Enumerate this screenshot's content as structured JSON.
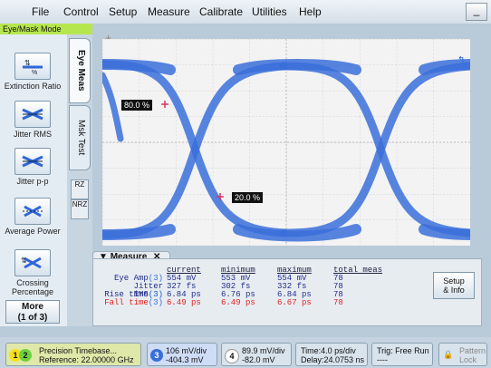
{
  "menu": {
    "items": [
      "File",
      "Control",
      "Setup",
      "Measure",
      "Calibrate",
      "Utilities",
      "Help"
    ],
    "minimize_label": "_"
  },
  "mode_label": "Eye/Mask Mode",
  "tools": [
    {
      "label": "Extinction Ratio",
      "icon": "extinction-ratio-icon"
    },
    {
      "label": "Jitter RMS",
      "icon": "jitter-rms-icon"
    },
    {
      "label": "Jitter p-p",
      "icon": "jitter-pp-icon"
    },
    {
      "label": "Average Power",
      "icon": "average-power-icon"
    },
    {
      "label": "Crossing Percentage",
      "icon": "crossing-percentage-icon"
    }
  ],
  "more_button": {
    "line1": "More",
    "line2": "(1 of 3)"
  },
  "vertical_tabs": {
    "eye_meas": "Eye Meas",
    "msk_test": "Msk Test"
  },
  "mini_tabs": {
    "rz": "RZ",
    "nrz": "NRZ"
  },
  "markers": {
    "upper": "80.0 %",
    "lower": "20.0 %"
  },
  "measure_panel": {
    "title": "Measure",
    "headers": [
      "current",
      "minimum",
      "maximum",
      "total meas"
    ],
    "rows": [
      {
        "label": "Eye Amp",
        "chan": "(3)",
        "current": "554 mV",
        "minimum": "553 mV",
        "maximum": "554 mV",
        "total": "78"
      },
      {
        "label": "Jitter RMS",
        "chan": "(3)",
        "current": "327 fs",
        "minimum": "302 fs",
        "maximum": "332 fs",
        "total": "78"
      },
      {
        "label": "Rise time",
        "chan": "(3)",
        "current": "6.84 ps",
        "minimum": "6.76 ps",
        "maximum": "6.84 ps",
        "total": "78"
      },
      {
        "label": "Fall time",
        "chan": "(3)",
        "current": "6.49 ps",
        "minimum": "6.49 ps",
        "maximum": "6.67 ps",
        "total": "78"
      }
    ],
    "setup_button": {
      "line1": "Setup",
      "line2": "& Info"
    }
  },
  "status": {
    "timebase": {
      "ch1": "1",
      "ch2": "2",
      "line1": "Precision Timebase...",
      "line2": "Reference: 22.00000 GHz"
    },
    "ch3": {
      "num": "3",
      "line1": "106 mV/div",
      "line2": "-404.3 mV"
    },
    "ch4": {
      "num": "4",
      "line1": "89.9 mV/div",
      "line2": "-82.0 mV"
    },
    "time": {
      "line1": "Time:4.0 ps/div",
      "line2": "Delay:24.0753 ns"
    },
    "trig": {
      "line1": "Trig: Free Run",
      "line2": "----"
    },
    "pattern_lock": {
      "line1": "Pattern",
      "line2": "Lock"
    }
  },
  "colors": {
    "trace": "#2f66d8",
    "marker": "#e03060",
    "fall_time": "#e02020",
    "mode_bg": "#b6e64e"
  }
}
